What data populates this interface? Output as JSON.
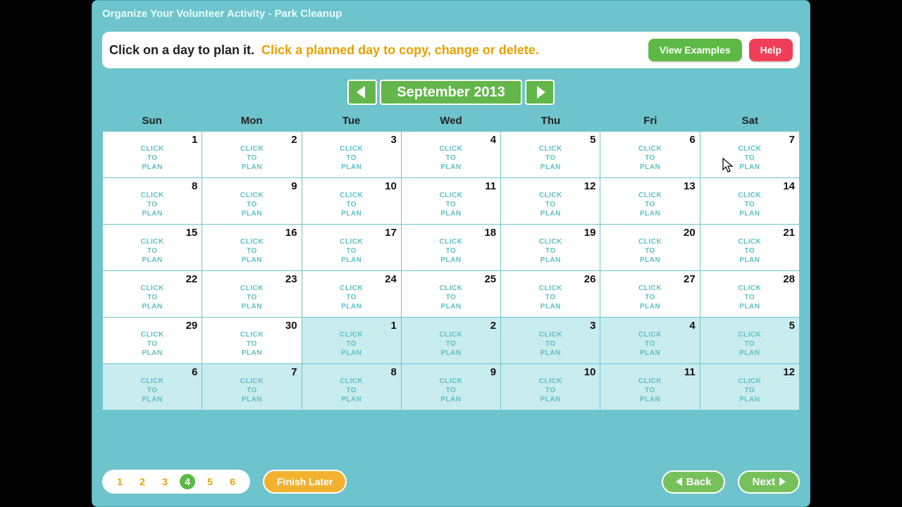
{
  "title": "Organize Your Volunteer Activity - Park Cleanup",
  "instruction1": "Click on a day to plan it.",
  "instruction2": "Click a planned day to copy, change or delete.",
  "buttons": {
    "view_examples": "View Examples",
    "help": "Help",
    "finish_later": "Finish Later",
    "back": "Back",
    "next": "Next"
  },
  "month": "September 2013",
  "day_headers": [
    "Sun",
    "Mon",
    "Tue",
    "Wed",
    "Thu",
    "Fri",
    "Sat"
  ],
  "cell_label": "CLICK\nTO\nPLAN",
  "weeks": [
    [
      {
        "n": 1,
        "o": false
      },
      {
        "n": 2,
        "o": false
      },
      {
        "n": 3,
        "o": false
      },
      {
        "n": 4,
        "o": false
      },
      {
        "n": 5,
        "o": false
      },
      {
        "n": 6,
        "o": false
      },
      {
        "n": 7,
        "o": false
      }
    ],
    [
      {
        "n": 8,
        "o": false
      },
      {
        "n": 9,
        "o": false
      },
      {
        "n": 10,
        "o": false
      },
      {
        "n": 11,
        "o": false
      },
      {
        "n": 12,
        "o": false
      },
      {
        "n": 13,
        "o": false
      },
      {
        "n": 14,
        "o": false
      }
    ],
    [
      {
        "n": 15,
        "o": false
      },
      {
        "n": 16,
        "o": false
      },
      {
        "n": 17,
        "o": false
      },
      {
        "n": 18,
        "o": false
      },
      {
        "n": 19,
        "o": false
      },
      {
        "n": 20,
        "o": false
      },
      {
        "n": 21,
        "o": false
      }
    ],
    [
      {
        "n": 22,
        "o": false
      },
      {
        "n": 23,
        "o": false
      },
      {
        "n": 24,
        "o": false
      },
      {
        "n": 25,
        "o": false
      },
      {
        "n": 26,
        "o": false
      },
      {
        "n": 27,
        "o": false
      },
      {
        "n": 28,
        "o": false
      }
    ],
    [
      {
        "n": 29,
        "o": false
      },
      {
        "n": 30,
        "o": false
      },
      {
        "n": 1,
        "o": true
      },
      {
        "n": 2,
        "o": true
      },
      {
        "n": 3,
        "o": true
      },
      {
        "n": 4,
        "o": true
      },
      {
        "n": 5,
        "o": true
      }
    ],
    [
      {
        "n": 6,
        "o": true
      },
      {
        "n": 7,
        "o": true
      },
      {
        "n": 8,
        "o": true
      },
      {
        "n": 9,
        "o": true
      },
      {
        "n": 10,
        "o": true
      },
      {
        "n": 11,
        "o": true
      },
      {
        "n": 12,
        "o": true
      }
    ]
  ],
  "steps": [
    "1",
    "2",
    "3",
    "4",
    "5",
    "6"
  ],
  "active_step": 4
}
